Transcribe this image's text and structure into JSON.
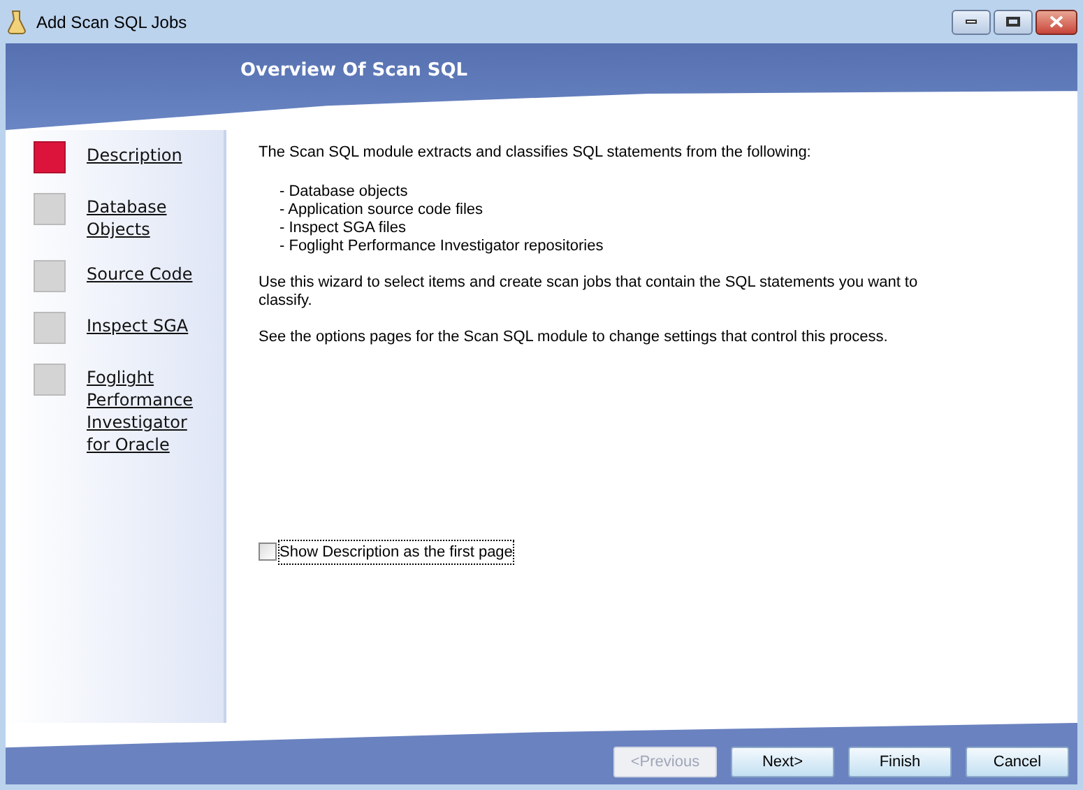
{
  "window": {
    "title": "Add Scan SQL Jobs"
  },
  "header": {
    "title": "Overview Of Scan SQL"
  },
  "steps": [
    {
      "label": "Description",
      "selected": true
    },
    {
      "label": "Database Objects",
      "selected": false
    },
    {
      "label": "Source Code",
      "selected": false
    },
    {
      "label": "Inspect SGA",
      "selected": false
    },
    {
      "label": "Foglight Performance Investigator for Oracle",
      "selected": false
    }
  ],
  "content": {
    "intro": "The Scan SQL module extracts and classifies SQL statements from the following:",
    "list": [
      "- Database objects",
      "- Application source code files",
      "- Inspect SGA files",
      "- Foglight Performance Investigator repositories"
    ],
    "paragraphs": [
      "Use this wizard to select items and create scan jobs that contain the SQL statements you want to classify.",
      "See the options pages for the Scan SQL module to change settings that control this process."
    ]
  },
  "option": {
    "label": "Show Description as the first page",
    "checked": false
  },
  "buttons": [
    {
      "label": "<Previous",
      "disabled": true
    },
    {
      "label": "Next>",
      "disabled": false
    },
    {
      "label": "Finish",
      "disabled": false
    },
    {
      "label": "Cancel",
      "disabled": false
    }
  ]
}
